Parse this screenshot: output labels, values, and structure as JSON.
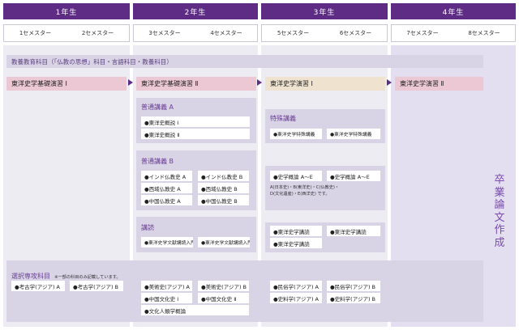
{
  "years": [
    "1年生",
    "2年生",
    "3年生",
    "4年生"
  ],
  "semesters": [
    [
      "1セメスター",
      "2セメスター"
    ],
    [
      "3セメスター",
      "4セメスター"
    ],
    [
      "5セメスター",
      "6セメスター"
    ],
    [
      "7セメスター",
      "8セメスター"
    ]
  ],
  "general_band": "教養教育科目（「仏教の思想」科目・言語科目・教養科目）",
  "seminars": [
    "東洋史学基礎演習 Ⅰ",
    "東洋史学基礎演習 Ⅱ",
    "東洋史学演習 Ⅰ",
    "東洋史学演習 Ⅱ"
  ],
  "lecture_a": {
    "title": "普通講義 A",
    "items": [
      "●東洋史概説 Ⅰ",
      "●東洋史概説 Ⅱ"
    ]
  },
  "special": {
    "title": "特殊講義",
    "items": [
      "●東洋史学特殊講義",
      "●東洋史学特殊講義"
    ]
  },
  "lecture_b": {
    "title": "普通講義 B",
    "items": [
      "●インド仏教史 A",
      "●インド仏教史 B",
      "●西域仏教史 A",
      "●西域仏教史 B",
      "●中国仏教史 A",
      "●中国仏教史 B"
    ]
  },
  "overview": {
    "items": [
      "●史学概論 A～E",
      "●史学概論 A～E"
    ],
    "note_line1": "A(日本史)・B(東洋史)・C(仏教史)・",
    "note_line2": "D(文化遺産)・E(西洋史) です。"
  },
  "reading": {
    "title": "講読",
    "items": [
      "●東洋史学文献講読入門 A",
      "●東洋史学文献講読入門 B"
    ]
  },
  "reading_y3": {
    "items": [
      "●東洋史学講読",
      "●東洋史学講読",
      "●東洋史学講読"
    ]
  },
  "elective": {
    "title": "選択専攻科目",
    "note": "※一部の科目のみ記載しています。",
    "y1": [
      "●考古学(アジア) A",
      "●考古学(アジア) B"
    ],
    "y2": [
      "●美術史(アジア) A",
      "●美術史(アジア) B",
      "●中国文化史 Ⅰ",
      "●中国文化史 Ⅱ",
      "●文化人類学概論"
    ],
    "y3": [
      "●民俗学(アジア) A",
      "●民俗学(アジア) B",
      "●史料学(アジア) A",
      "●史料学(アジア) B"
    ]
  },
  "graduation": "卒業論文作成",
  "colors": {
    "purple": "#5e2c85",
    "pink": "#ecc8d5",
    "beige": "#efe3d0",
    "lavender": "#d9d3e6"
  }
}
